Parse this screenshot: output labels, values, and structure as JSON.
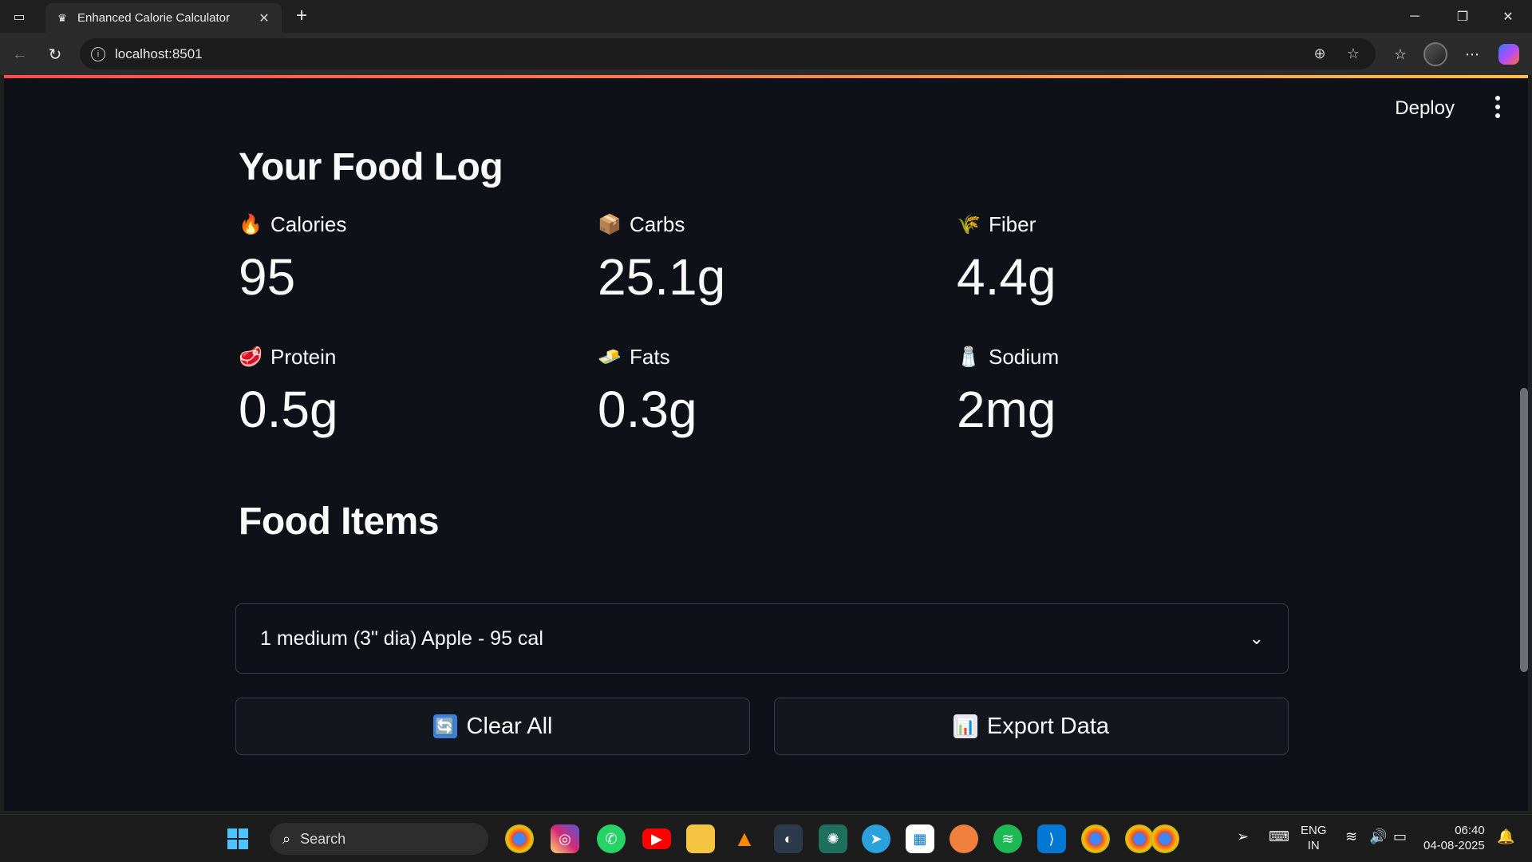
{
  "browser": {
    "tab_title": "Enhanced Calorie Calculator",
    "url": "localhost:8501"
  },
  "app": {
    "deploy_label": "Deploy",
    "food_log_title": "Your Food Log",
    "metrics": [
      {
        "emoji": "🔥",
        "label": "Calories",
        "value": "95"
      },
      {
        "emoji": "📦",
        "label": "Carbs",
        "value": "25.1g"
      },
      {
        "emoji": "🌾",
        "label": "Fiber",
        "value": "4.4g"
      },
      {
        "emoji": "🥩",
        "label": "Protein",
        "value": "0.5g"
      },
      {
        "emoji": "🧈",
        "label": "Fats",
        "value": "0.3g"
      },
      {
        "emoji": "🧂",
        "label": "Sodium",
        "value": "2mg"
      }
    ],
    "food_items_title": "Food Items",
    "food_items": [
      {
        "label": "1 medium (3\" dia) Apple - 95 cal"
      }
    ],
    "buttons": {
      "clear_all": "Clear All",
      "export_data": "Export Data"
    }
  },
  "taskbar": {
    "search_placeholder": "Search",
    "language": "ENG",
    "region": "IN",
    "time": "06:40",
    "date": "04-08-2025"
  },
  "colors": {
    "app_bg": "#0e1117",
    "accent_start": "#ff4b4b",
    "accent_end": "#ffbd45"
  }
}
